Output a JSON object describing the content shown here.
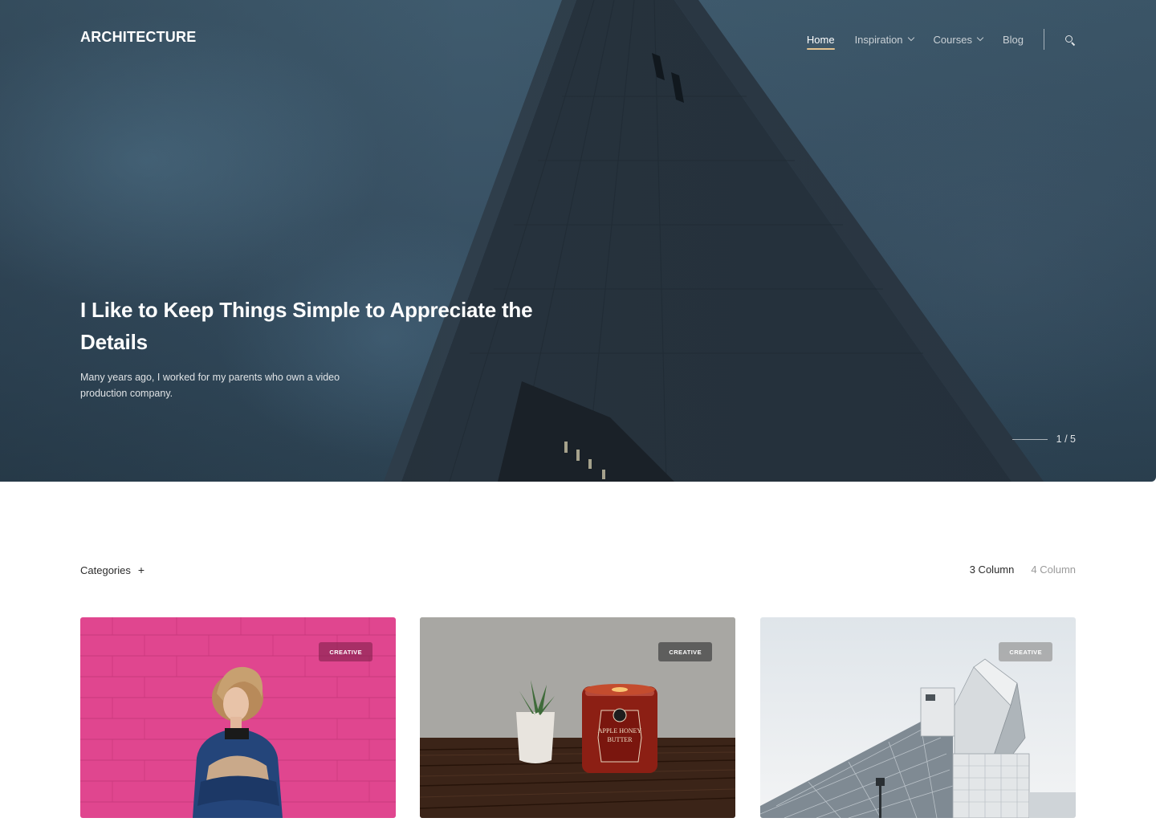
{
  "brand": {
    "logo_text": "ARCHITECTURE"
  },
  "nav": {
    "items": [
      {
        "label": "Home",
        "active": true,
        "dropdown": false
      },
      {
        "label": "Inspiration",
        "active": false,
        "dropdown": true
      },
      {
        "label": "Courses",
        "active": false,
        "dropdown": true
      },
      {
        "label": "Blog",
        "active": false,
        "dropdown": false
      }
    ],
    "search_icon": "search-icon",
    "active_underline_color": "#e3c28f"
  },
  "hero": {
    "title": "I Like to Keep Things Simple to Appreciate the Details",
    "subtitle": "Many years ago, I worked for my parents who own a video production company.",
    "slider": {
      "current": 1,
      "total": 5,
      "label": "1 / 5"
    }
  },
  "filters": {
    "categories_label": "Categories",
    "categories_icon": "plus-icon",
    "columns": [
      {
        "label": "3 Column",
        "active": true
      },
      {
        "label": "4 Column",
        "active": false
      }
    ]
  },
  "cards": [
    {
      "badge": "CREATIVE",
      "scene": "woman-pink-wall"
    },
    {
      "badge": "CREATIVE",
      "scene": "candle-and-plant"
    },
    {
      "badge": "CREATIVE",
      "scene": "glass-building"
    }
  ],
  "candle_label": {
    "line1": "APPLE HONEY",
    "line2": "BUTTER"
  }
}
